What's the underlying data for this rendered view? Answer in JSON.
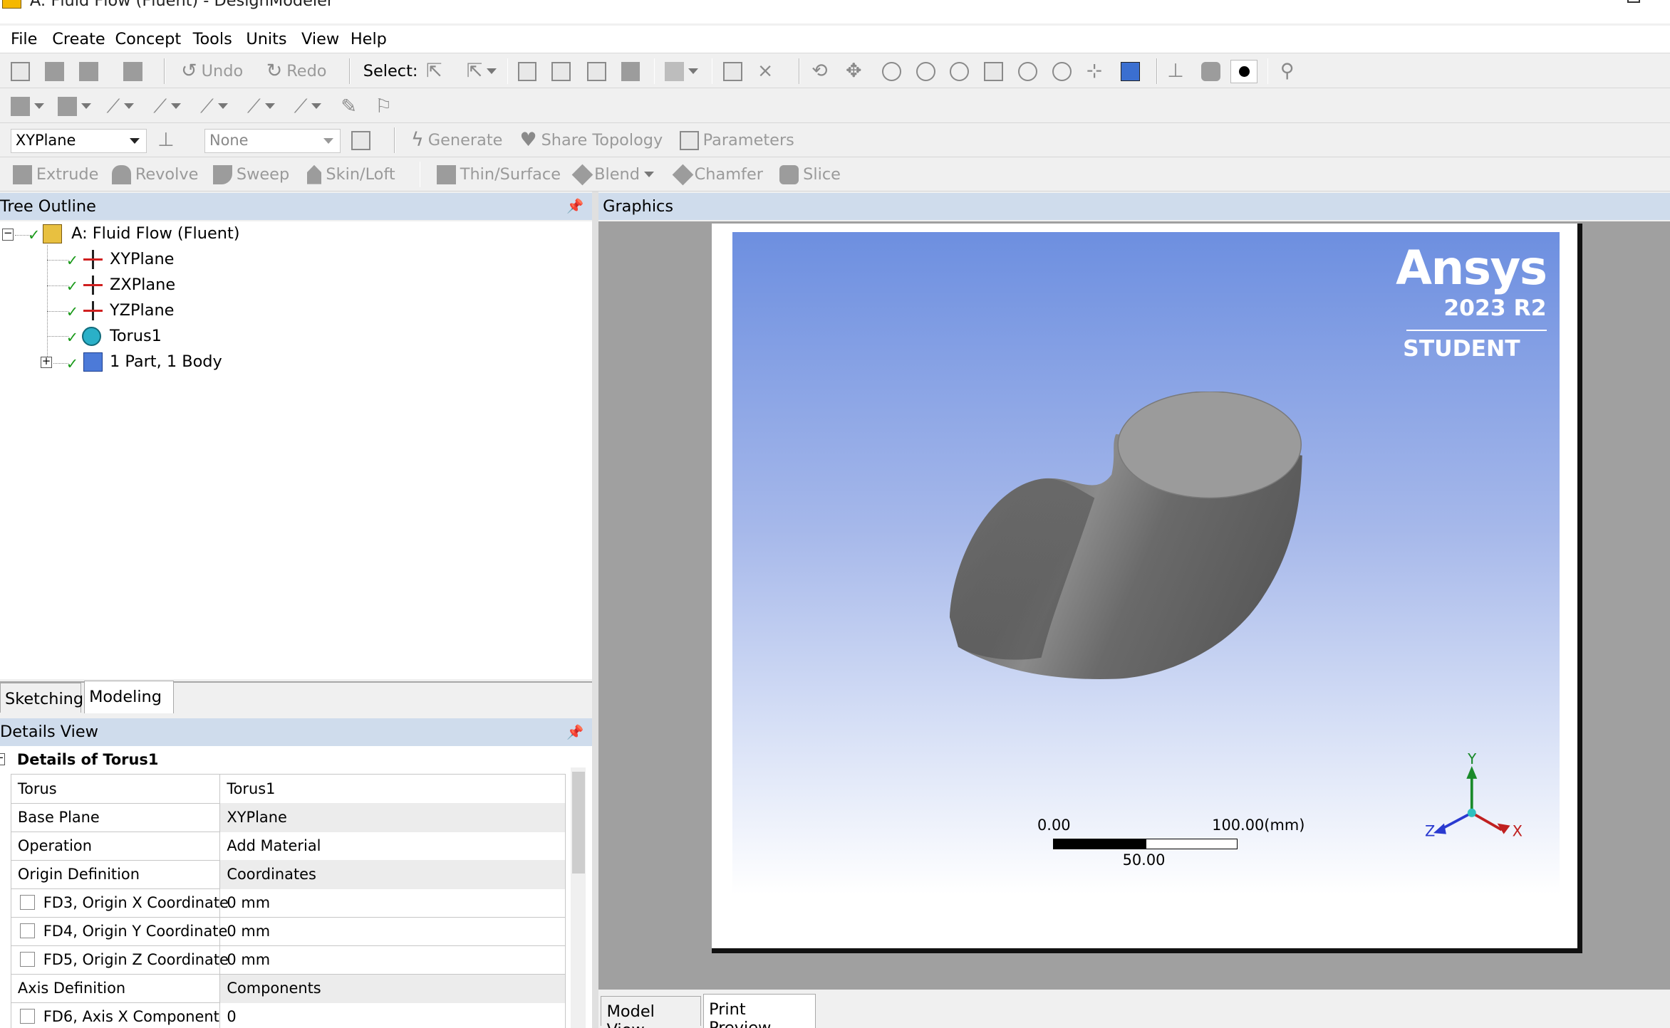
{
  "window": {
    "title": "A: Fluid Flow (Fluent) - DesignModeler"
  },
  "menu": [
    "File",
    "Create",
    "Concept",
    "Tools",
    "Units",
    "View",
    "Help"
  ],
  "toolbar1": {
    "undo": "Undo",
    "redo": "Redo",
    "select": "Select:"
  },
  "toolbar3": {
    "plane_combo": "XYPlane",
    "sketch_combo": "None",
    "generate": "Generate",
    "share_topology": "Share Topology",
    "parameters": "Parameters"
  },
  "toolbar4": {
    "extrude": "Extrude",
    "revolve": "Revolve",
    "sweep": "Sweep",
    "skinloft": "Skin/Loft",
    "thinsurface": "Thin/Surface",
    "blend": "Blend",
    "chamfer": "Chamfer",
    "slice": "Slice"
  },
  "tree_outline": {
    "title": "Tree Outline",
    "root": "A: Fluid Flow (Fluent)",
    "items": [
      "XYPlane",
      "ZXPlane",
      "YZPlane",
      "Torus1",
      "1 Part, 1 Body"
    ]
  },
  "left_tabs": {
    "sketching": "Sketching",
    "modeling": "Modeling"
  },
  "details": {
    "title": "Details View",
    "group": "Details of Torus1",
    "rows": [
      {
        "label": "Torus",
        "value": "Torus1",
        "checkbox": false,
        "grey": false
      },
      {
        "label": "Base Plane",
        "value": "XYPlane",
        "checkbox": false,
        "grey": true
      },
      {
        "label": "Operation",
        "value": "Add Material",
        "checkbox": false,
        "grey": false
      },
      {
        "label": "Origin Definition",
        "value": "Coordinates",
        "checkbox": false,
        "grey": true
      },
      {
        "label": "FD3, Origin X Coordinate",
        "value": "0 mm",
        "checkbox": true,
        "grey": false
      },
      {
        "label": "FD4, Origin Y Coordinate",
        "value": "0 mm",
        "checkbox": true,
        "grey": false
      },
      {
        "label": "FD5, Origin Z Coordinate",
        "value": "0 mm",
        "checkbox": true,
        "grey": false
      },
      {
        "label": "Axis Definition",
        "value": "Components",
        "checkbox": false,
        "grey": true
      },
      {
        "label": "FD6, Axis X Component",
        "value": "0",
        "checkbox": true,
        "grey": false
      }
    ]
  },
  "graphics": {
    "title": "Graphics",
    "logo": {
      "brand": "Ansys",
      "version": "2023 R2",
      "edition": "STUDENT"
    },
    "scale": {
      "start": "0.00",
      "mid": "50.00",
      "end": "100.00(mm)"
    },
    "axes": {
      "x": "X",
      "y": "Y",
      "z": "Z"
    }
  },
  "graphics_tabs": {
    "model_view": "Model View",
    "print_preview": "Print Preview"
  },
  "colors": {
    "panel_header": "#cfdcec",
    "viewport_top": "#6d8fe0",
    "body_grey": "#7a7a7a"
  }
}
